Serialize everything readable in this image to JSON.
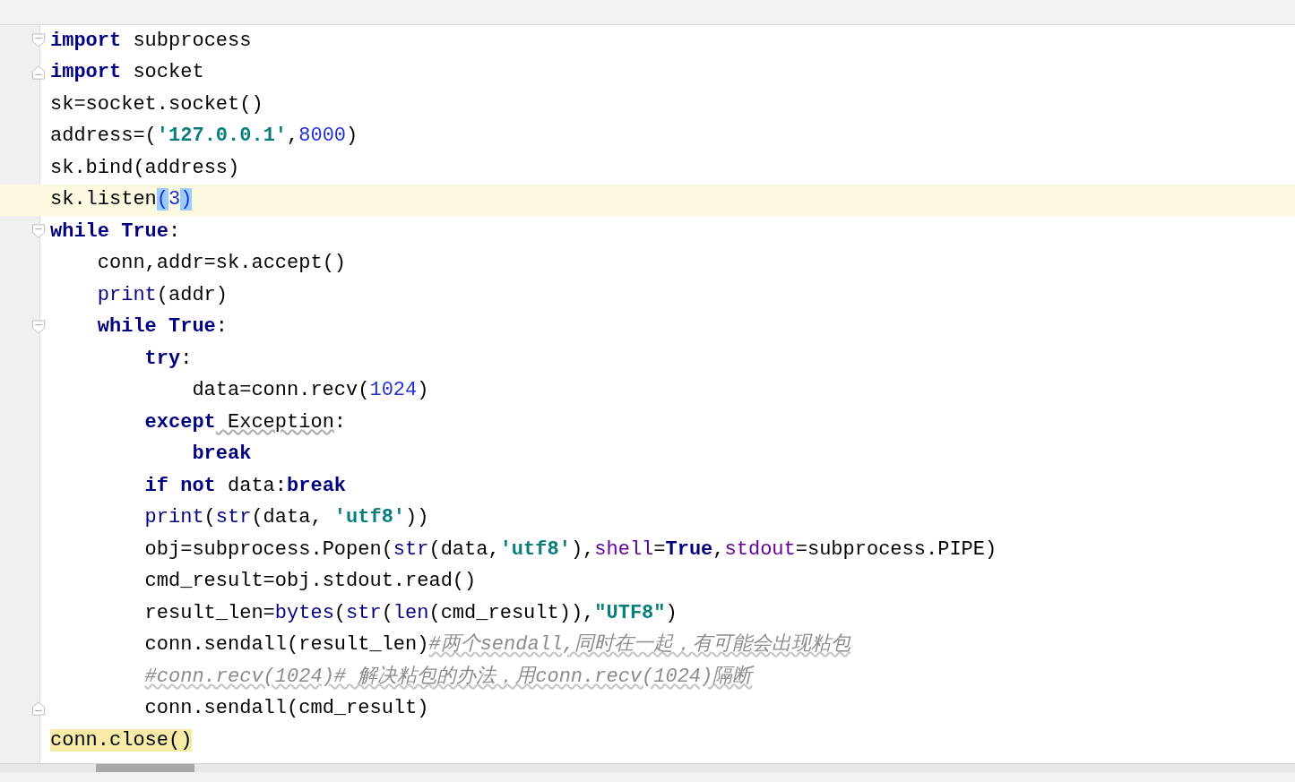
{
  "editor": {
    "lines": [
      {
        "fold_start": true,
        "fold_end": false,
        "current": false,
        "tokens": [
          {
            "kind": "kw",
            "text": "import"
          },
          {
            "kind": "plain",
            "text": " subprocess"
          }
        ]
      },
      {
        "fold_start": false,
        "fold_end": true,
        "current": false,
        "tokens": [
          {
            "kind": "kw",
            "text": "import"
          },
          {
            "kind": "plain",
            "text": " socket"
          }
        ]
      },
      {
        "fold_start": false,
        "fold_end": false,
        "current": false,
        "tokens": [
          {
            "kind": "plain",
            "text": "sk=socket.socket()"
          }
        ]
      },
      {
        "fold_start": false,
        "fold_end": false,
        "current": false,
        "tokens": [
          {
            "kind": "plain",
            "text": "address=("
          },
          {
            "kind": "str",
            "text": "'127.0.0.1'"
          },
          {
            "kind": "plain",
            "text": ","
          },
          {
            "kind": "num",
            "text": "8000"
          },
          {
            "kind": "plain",
            "text": ")"
          }
        ]
      },
      {
        "fold_start": false,
        "fold_end": false,
        "current": false,
        "tokens": [
          {
            "kind": "plain",
            "text": "sk.bind(address)"
          }
        ]
      },
      {
        "fold_start": false,
        "fold_end": false,
        "current": true,
        "tokens": [
          {
            "kind": "plain",
            "text": "sk.listen"
          },
          {
            "kind": "match",
            "text": "("
          },
          {
            "kind": "num",
            "text": "3"
          },
          {
            "kind": "match",
            "text": ")"
          }
        ]
      },
      {
        "fold_start": true,
        "fold_end": false,
        "current": false,
        "tokens": [
          {
            "kind": "kw",
            "text": "while True"
          },
          {
            "kind": "plain",
            "text": ":"
          }
        ],
        "children": [
          {
            "fold_start": false,
            "fold_end": false,
            "current": false,
            "tokens": [
              {
                "kind": "plain",
                "text": "conn,addr=sk.accept()"
              }
            ]
          },
          {
            "fold_start": false,
            "fold_end": false,
            "current": false,
            "tokens": [
              {
                "kind": "builtin",
                "text": "print"
              },
              {
                "kind": "plain",
                "text": "(addr)"
              }
            ]
          },
          {
            "fold_start": true,
            "fold_end": false,
            "current": false,
            "tokens": [
              {
                "kind": "kw",
                "text": "while True"
              },
              {
                "kind": "plain",
                "text": ":"
              }
            ],
            "children": [
              {
                "fold_start": false,
                "fold_end": false,
                "current": false,
                "tokens": [
                  {
                    "kind": "kw",
                    "text": "try"
                  },
                  {
                    "kind": "plain",
                    "text": ":"
                  }
                ],
                "children": [
                  {
                    "fold_start": false,
                    "fold_end": false,
                    "current": false,
                    "tokens": [
                      {
                        "kind": "plain",
                        "text": "data=conn.recv("
                      },
                      {
                        "kind": "num",
                        "text": "1024"
                      },
                      {
                        "kind": "plain",
                        "text": ")"
                      }
                    ]
                  }
                ]
              },
              {
                "fold_start": false,
                "fold_end": false,
                "current": false,
                "tokens": [
                  {
                    "kind": "kw",
                    "text": "except"
                  },
                  {
                    "kind": "warn",
                    "text": " Exception"
                  },
                  {
                    "kind": "plain",
                    "text": ":"
                  }
                ],
                "children": [
                  {
                    "fold_start": false,
                    "fold_end": false,
                    "current": false,
                    "tokens": [
                      {
                        "kind": "kw",
                        "text": "break"
                      }
                    ]
                  }
                ]
              },
              {
                "fold_start": false,
                "fold_end": false,
                "current": false,
                "tokens": [
                  {
                    "kind": "kw",
                    "text": "if not"
                  },
                  {
                    "kind": "plain",
                    "text": " data:"
                  },
                  {
                    "kind": "kw",
                    "text": "break"
                  }
                ]
              },
              {
                "fold_start": false,
                "fold_end": false,
                "current": false,
                "tokens": [
                  {
                    "kind": "builtin",
                    "text": "print"
                  },
                  {
                    "kind": "plain",
                    "text": "("
                  },
                  {
                    "kind": "builtin",
                    "text": "str"
                  },
                  {
                    "kind": "plain",
                    "text": "(data, "
                  },
                  {
                    "kind": "str",
                    "text": "'utf8'"
                  },
                  {
                    "kind": "plain",
                    "text": "))"
                  }
                ]
              },
              {
                "fold_start": false,
                "fold_end": false,
                "current": false,
                "tokens": [
                  {
                    "kind": "plain",
                    "text": "obj=subprocess.Popen("
                  },
                  {
                    "kind": "builtin",
                    "text": "str"
                  },
                  {
                    "kind": "plain",
                    "text": "(data,"
                  },
                  {
                    "kind": "str",
                    "text": "'utf8'"
                  },
                  {
                    "kind": "plain",
                    "text": "),"
                  },
                  {
                    "kind": "param",
                    "text": "shell"
                  },
                  {
                    "kind": "plain",
                    "text": "="
                  },
                  {
                    "kind": "kw",
                    "text": "True"
                  },
                  {
                    "kind": "plain",
                    "text": ","
                  },
                  {
                    "kind": "param",
                    "text": "stdout"
                  },
                  {
                    "kind": "plain",
                    "text": "=subprocess.PIPE)"
                  }
                ]
              },
              {
                "fold_start": false,
                "fold_end": false,
                "current": false,
                "tokens": [
                  {
                    "kind": "plain",
                    "text": "cmd_result=obj.stdout.read()"
                  }
                ]
              },
              {
                "fold_start": false,
                "fold_end": false,
                "current": false,
                "tokens": [
                  {
                    "kind": "plain",
                    "text": "result_len="
                  },
                  {
                    "kind": "builtin",
                    "text": "bytes"
                  },
                  {
                    "kind": "plain",
                    "text": "("
                  },
                  {
                    "kind": "builtin",
                    "text": "str"
                  },
                  {
                    "kind": "plain",
                    "text": "("
                  },
                  {
                    "kind": "builtin",
                    "text": "len"
                  },
                  {
                    "kind": "plain",
                    "text": "(cmd_result)),"
                  },
                  {
                    "kind": "str",
                    "text": "\"UTF8\""
                  },
                  {
                    "kind": "plain",
                    "text": ")"
                  }
                ]
              },
              {
                "fold_start": false,
                "fold_end": false,
                "current": false,
                "tokens": [
                  {
                    "kind": "plain",
                    "text": "conn.sendall(result_len)"
                  },
                  {
                    "kind": "comment",
                    "text": "#两个sendall,同时在一起，有可能会出现粘包"
                  }
                ]
              },
              {
                "fold_start": false,
                "fold_end": false,
                "current": false,
                "tokens": [
                  {
                    "kind": "comment",
                    "text": "#conn.recv(1024)# 解决粘包的办法，用conn.recv(1024)隔断"
                  }
                ]
              },
              {
                "fold_start": false,
                "fold_end": true,
                "current": false,
                "tokens": [
                  {
                    "kind": "plain",
                    "text": "conn.sendall(cmd_result)"
                  }
                ]
              }
            ]
          }
        ]
      },
      {
        "fold_start": false,
        "fold_end": false,
        "current": false,
        "tokens": [
          {
            "kind": "marked",
            "text": "conn.close()"
          }
        ]
      }
    ]
  }
}
